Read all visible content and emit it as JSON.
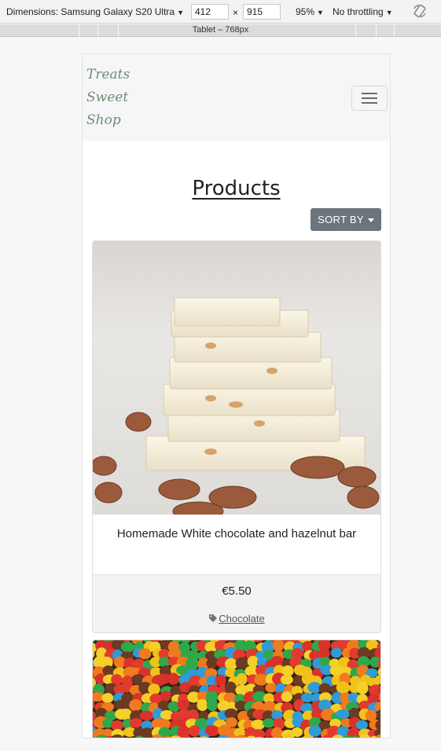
{
  "devtools": {
    "dimensions_label": "Dimensions: Samsung Galaxy S20 Ultra",
    "width": "412",
    "height": "915",
    "times": "×",
    "zoom": "95%",
    "throttling": "No throttling",
    "breakpoint_label": "Tablet – 768px"
  },
  "navbar": {
    "brand_line1": "Treats",
    "brand_line2": "Sweet",
    "brand_line3": "Shop",
    "toggler_icon": "hamburger-icon"
  },
  "page": {
    "title": "Products",
    "sort_label": "SORT BY"
  },
  "products": [
    {
      "name": "Homemade White chocolate and hazelnut bar",
      "price": "€5.50",
      "category": "Chocolate",
      "image": "white-chocolate-image"
    },
    {
      "image": "colored-candies-image"
    }
  ],
  "colors": {
    "brand": "#6d8e73",
    "sort_button": "#6c757d",
    "card_footer": "#f3f3f3"
  }
}
